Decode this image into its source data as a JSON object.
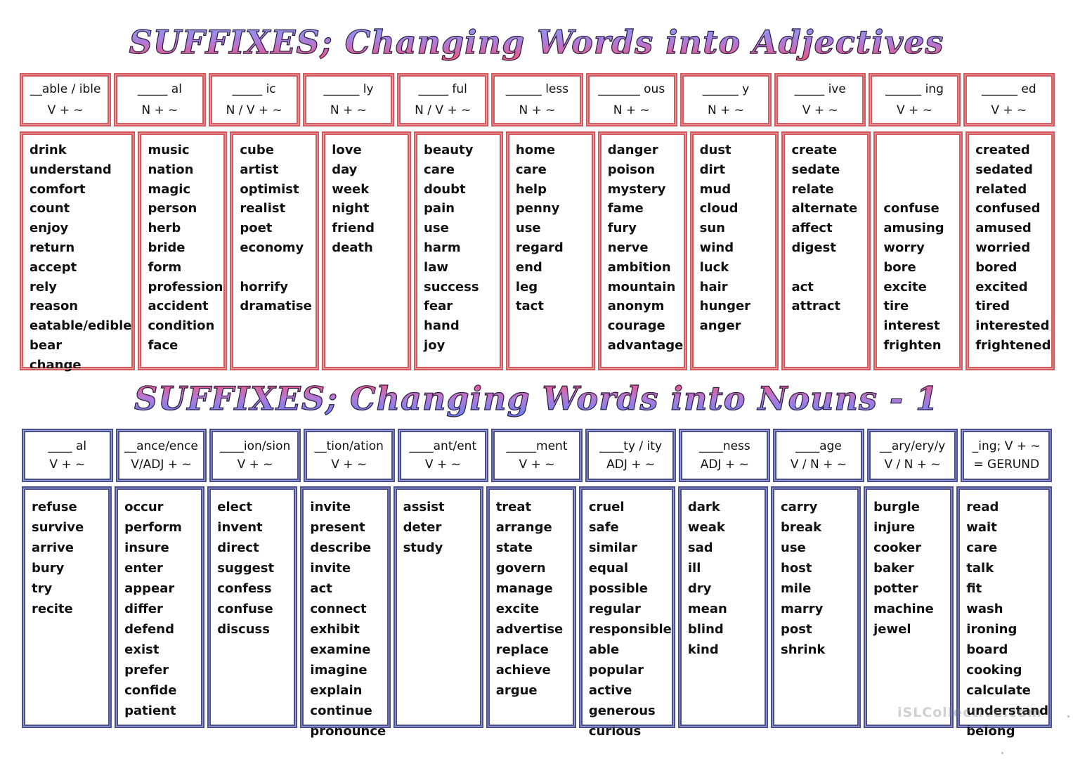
{
  "adjectives": {
    "title": "SUFFIXES; Changing Words into Adjectives",
    "columns": [
      {
        "suffix": "__able / ible",
        "formula": "V + ~",
        "words": [
          "drink",
          "understand",
          "comfort",
          "count",
          "enjoy",
          "return",
          "accept",
          "rely",
          "reason",
          "eatable/edible",
          "bear",
          "change"
        ]
      },
      {
        "suffix": "_____ al",
        "formula": "N + ~",
        "words": [
          "music",
          "nation",
          "magic",
          "person",
          "herb",
          "bride",
          "form",
          "profession",
          "accident",
          "condition",
          "face"
        ]
      },
      {
        "suffix": "_____ ic",
        "formula": "N / V + ~",
        "words": [
          "cube",
          "artist",
          "optimist",
          "realist",
          "poet",
          "economy",
          "",
          "horrify",
          "dramatise"
        ]
      },
      {
        "suffix": "______ ly",
        "formula": "N + ~",
        "words": [
          "love",
          "day",
          "week",
          "night",
          "friend",
          "death"
        ]
      },
      {
        "suffix": "_____ ful",
        "formula": "N / V + ~",
        "words": [
          "beauty",
          "care",
          "doubt",
          "pain",
          "use",
          "harm",
          "law",
          "success",
          "fear",
          "hand",
          "joy"
        ]
      },
      {
        "suffix": "______ less",
        "formula": "N + ~",
        "words": [
          "home",
          "care",
          "help",
          "penny",
          "use",
          "regard",
          "end",
          "leg",
          "tact"
        ]
      },
      {
        "suffix": "_______ ous",
        "formula": "N + ~",
        "words": [
          "danger",
          "poison",
          "mystery",
          "fame",
          "fury",
          "nerve",
          "ambition",
          "mountain",
          "anonym",
          "courage",
          "advantage"
        ]
      },
      {
        "suffix": "______ y",
        "formula": "N + ~",
        "words": [
          "dust",
          "dirt",
          "mud",
          "cloud",
          "sun",
          "wind",
          "luck",
          "hair",
          "hunger",
          "anger"
        ]
      },
      {
        "suffix": "_____ ive",
        "formula": "V + ~",
        "words": [
          "create",
          "sedate",
          "relate",
          "alternate",
          "affect",
          "digest",
          "",
          "act",
          "attract"
        ]
      },
      {
        "suffix": "______ ing",
        "formula": "V +  ~",
        "words": [
          "",
          "",
          "",
          "confuse",
          "amusing",
          "worry",
          "bore",
          "excite",
          "tire",
          "interest",
          "frighten"
        ]
      },
      {
        "suffix": "______ ed",
        "formula": "V + ~",
        "words": [
          "created",
          "sedated",
          "related",
          "confused",
          "amused",
          "worried",
          "bored",
          "excited",
          "tired",
          "interested",
          "frightened"
        ]
      }
    ]
  },
  "nouns": {
    "title": "SUFFIXES; Changing Words into Nouns - 1",
    "columns": [
      {
        "suffix": "____ al",
        "formula": "V + ~",
        "words": [
          "refuse",
          "survive",
          "arrive",
          "bury",
          "try",
          "recite"
        ]
      },
      {
        "suffix": "__ance/ence",
        "formula": "V/ADJ + ~",
        "words": [
          "occur",
          "perform",
          "insure",
          "enter",
          "appear",
          "differ",
          "defend",
          "exist",
          "prefer",
          "confide",
          "patient"
        ]
      },
      {
        "suffix": "____ion/sion",
        "formula": "V + ~",
        "words": [
          "elect",
          "invent",
          "direct",
          "suggest",
          "confess",
          "confuse",
          "discuss"
        ]
      },
      {
        "suffix": "__tion/ation",
        "formula": "V + ~",
        "words": [
          "invite",
          "present",
          "describe",
          "invite",
          "act",
          "connect",
          "exhibit",
          "examine",
          "imagine",
          "explain",
          "continue",
          "pronounce"
        ]
      },
      {
        "suffix": "____ant/ent",
        "formula": "V + ~",
        "words": [
          "assist",
          "deter",
          "study"
        ]
      },
      {
        "suffix": "_____ment",
        "formula": "V + ~",
        "words": [
          "treat",
          "arrange",
          "state",
          "govern",
          "manage",
          "excite",
          "advertise",
          "replace",
          "achieve",
          "argue"
        ]
      },
      {
        "suffix": "____ty / ity",
        "formula": "ADJ + ~",
        "words": [
          "cruel",
          "safe",
          "similar",
          "equal",
          "possible",
          "regular",
          "responsible",
          "able",
          "popular",
          "active",
          "generous",
          "curious"
        ]
      },
      {
        "suffix": "____ness",
        "formula": "ADJ + ~",
        "words": [
          "dark",
          "weak",
          "sad",
          "ill",
          "dry",
          "mean",
          "blind",
          "kind"
        ]
      },
      {
        "suffix": "____age",
        "formula": "V / N + ~",
        "words": [
          "carry",
          "break",
          "use",
          "host",
          "mile",
          "marry",
          "post",
          "shrink"
        ]
      },
      {
        "suffix": "__ary/ery/y",
        "formula": "V / N + ~",
        "words": [
          "burgle",
          "injure",
          "cooker",
          "baker",
          "potter",
          "machine",
          "jewel"
        ]
      },
      {
        "suffix": "_ing; V + ~",
        "formula": "= GERUND",
        "words": [
          "read",
          "wait",
          "care",
          "talk",
          "fit",
          "wash",
          "ironing",
          "board",
          "cooking",
          "calculate",
          "understand",
          "belong"
        ]
      }
    ]
  },
  "watermark": "iSLCollective.com",
  "colors": {
    "adjective_border": "#d45a5f",
    "noun_border": "#4a4f8f"
  }
}
